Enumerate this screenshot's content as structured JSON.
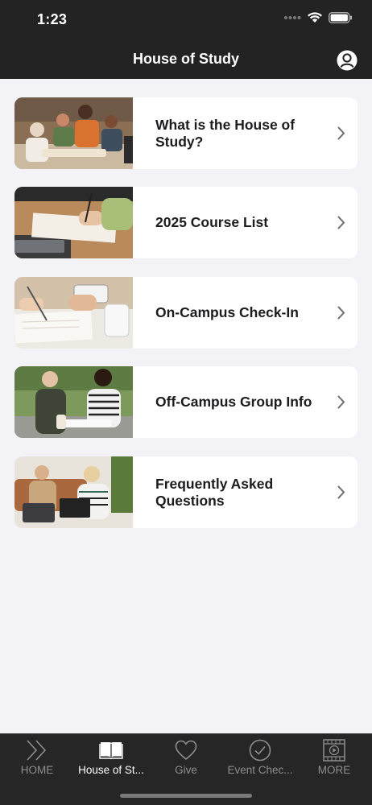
{
  "status_bar": {
    "time": "1:23"
  },
  "header": {
    "title": "House of Study"
  },
  "cards": [
    {
      "label": "What is the House of Study?"
    },
    {
      "label": "2025 Course List"
    },
    {
      "label": "On-Campus Check-In"
    },
    {
      "label": "Off-Campus Group Info"
    },
    {
      "label": "Frequently Asked Questions"
    }
  ],
  "tabs": [
    {
      "label": "HOME",
      "icon": "double-chevron-icon"
    },
    {
      "label": "House of St...",
      "icon": "book-icon",
      "active": true
    },
    {
      "label": "Give",
      "icon": "heart-icon"
    },
    {
      "label": "Event Chec...",
      "icon": "check-circle-icon"
    },
    {
      "label": "MORE",
      "icon": "film-play-icon"
    }
  ],
  "colors": {
    "header_bg": "#232323",
    "page_bg": "#f2f2f7",
    "card_bg": "#ffffff",
    "tab_active": "#ffffff",
    "tab_inactive": "#8e8e8e"
  }
}
